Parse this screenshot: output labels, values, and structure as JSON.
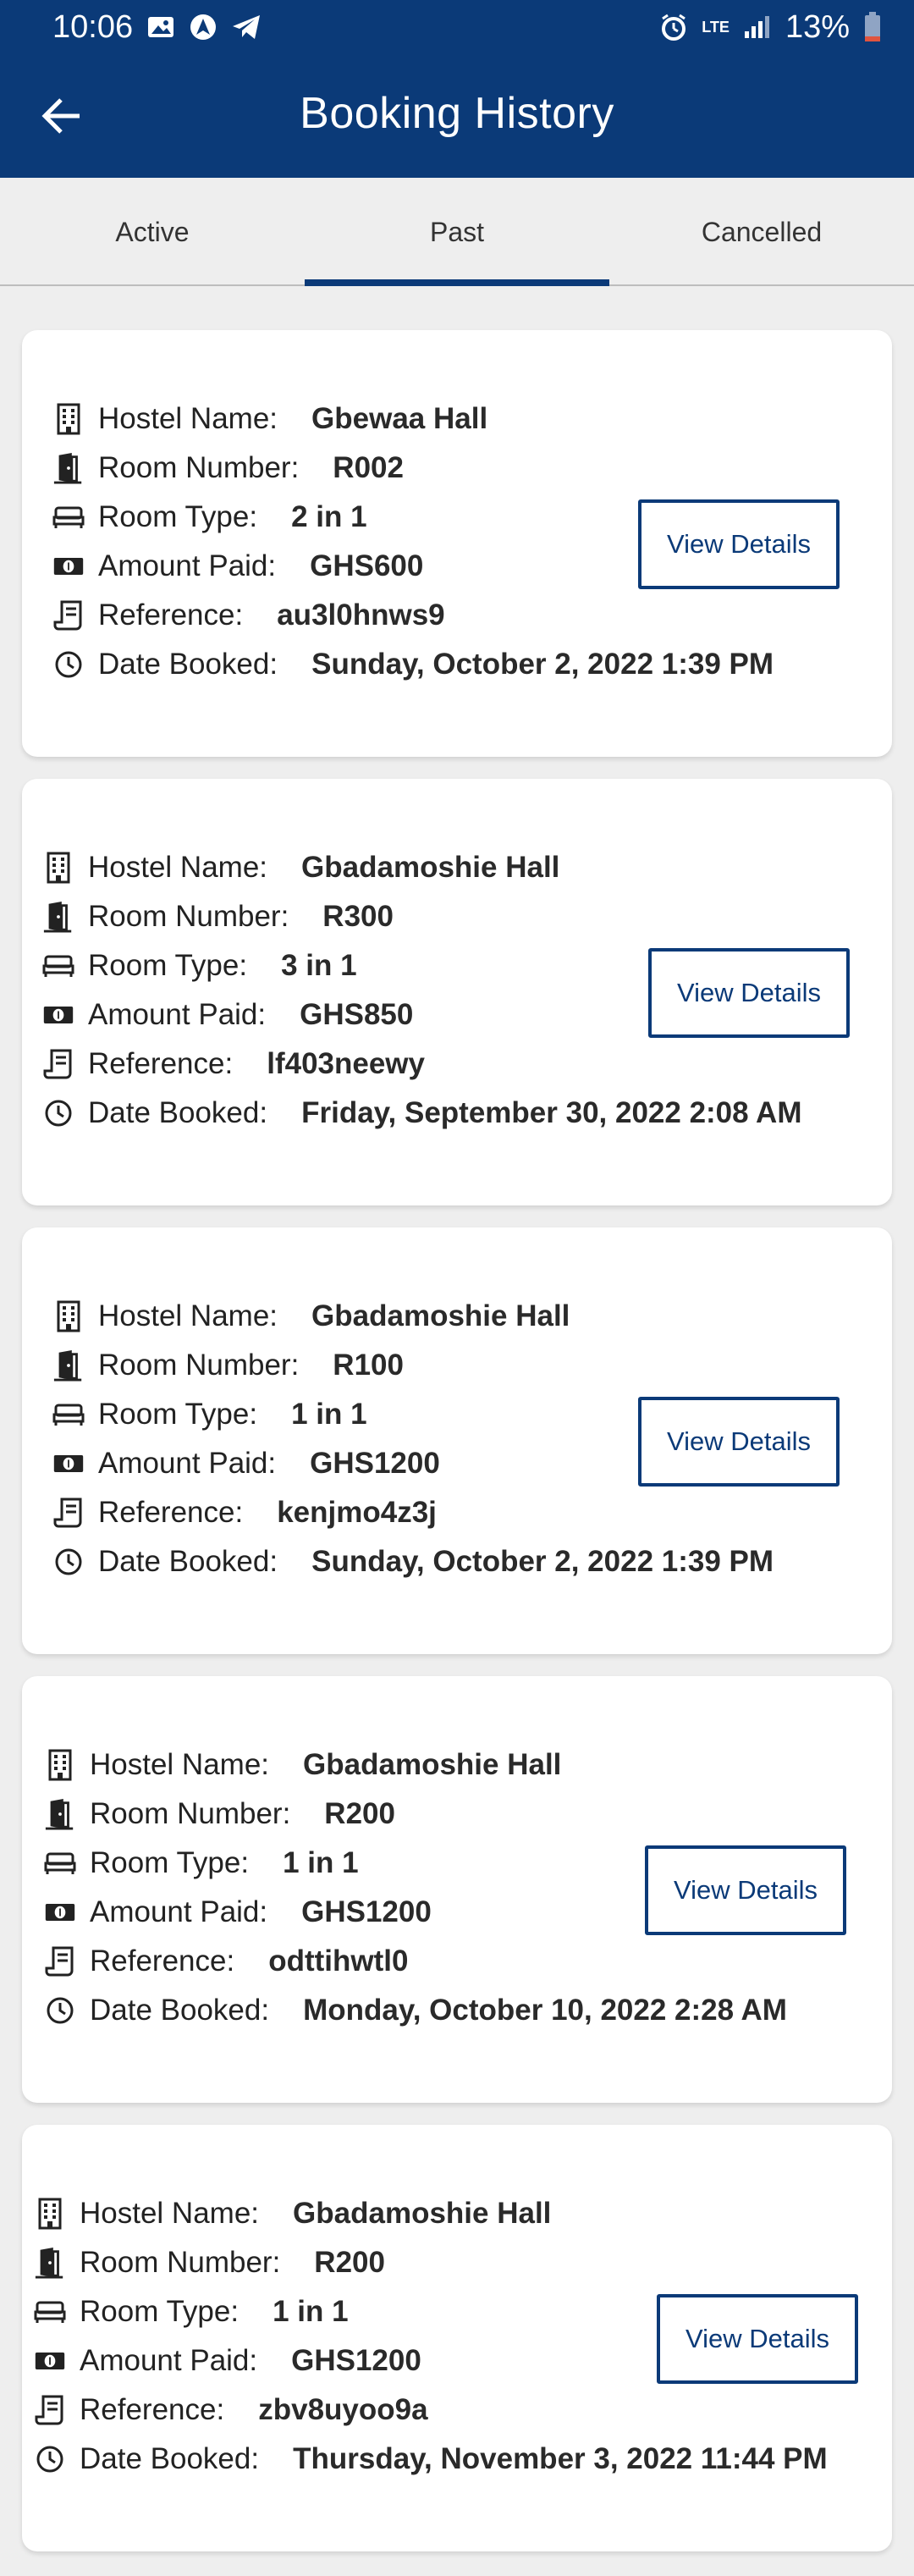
{
  "status_bar": {
    "time": "10:06",
    "battery": "13%",
    "network": "LTE"
  },
  "app_bar": {
    "title": "Booking History"
  },
  "tabs": [
    {
      "label": "Active"
    },
    {
      "label": "Past"
    },
    {
      "label": "Cancelled"
    }
  ],
  "selected_tab": "Past",
  "labels": {
    "hostel": "Hostel Name:",
    "room": "Room Number:",
    "type": "Room Type:",
    "amount": "Amount Paid:",
    "reference": "Reference:",
    "date": "Date Booked:",
    "view_details": "View Details"
  },
  "bookings": [
    {
      "hostel": "Gbewaa Hall",
      "room": "R002",
      "type": "2 in 1",
      "amount": "GHS600",
      "reference": "au3l0hnws9",
      "date": "Sunday, October 2, 2022 1:39 PM"
    },
    {
      "hostel": "Gbadamoshie Hall",
      "room": "R300",
      "type": "3 in 1",
      "amount": "GHS850",
      "reference": "lf403neewy",
      "date": "Friday, September 30, 2022 2:08 AM"
    },
    {
      "hostel": "Gbadamoshie Hall",
      "room": "R100",
      "type": "1 in 1",
      "amount": "GHS1200",
      "reference": "kenjmo4z3j",
      "date": "Sunday, October 2, 2022 1:39 PM"
    },
    {
      "hostel": "Gbadamoshie Hall",
      "room": "R200",
      "type": "1 in 1",
      "amount": "GHS1200",
      "reference": "odttihwtl0",
      "date": "Monday, October 10, 2022 2:28 AM"
    },
    {
      "hostel": "Gbadamoshie Hall",
      "room": "R200",
      "type": "1 in 1",
      "amount": "GHS1200",
      "reference": "zbv8uyoo9a",
      "date": "Thursday, November 3, 2022 11:44 PM"
    }
  ],
  "colors": {
    "primary": "#0b3a78",
    "background": "#eeeeee",
    "card": "#ffffff"
  }
}
